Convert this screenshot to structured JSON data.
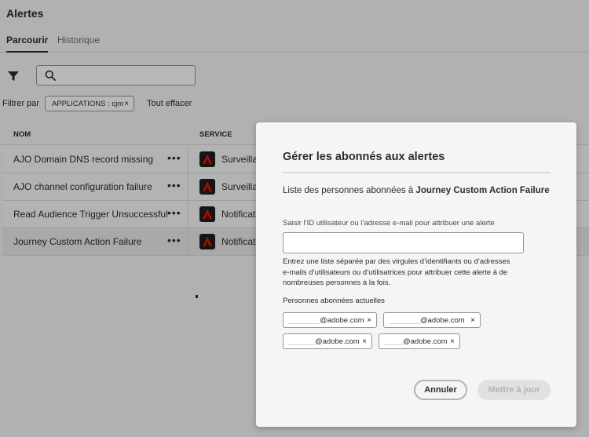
{
  "page": {
    "title": "Alertes"
  },
  "tabs": [
    {
      "label": "Parcourir",
      "active": true
    },
    {
      "label": "Historique",
      "active": false
    }
  ],
  "toolbar": {
    "search_value": "",
    "filter_icon": "filter-icon",
    "search_icon": "search-icon"
  },
  "filters": {
    "label": "Filtrer par",
    "chip": "APPLICATIONS : cjm",
    "chip_remove": "×",
    "clear_all": "Tout effacer"
  },
  "table": {
    "columns": [
      "NOM",
      "SERVICE"
    ],
    "rows": [
      {
        "name": "AJO Domain DNS record missing",
        "more": "•••",
        "service": "Surveillan"
      },
      {
        "name": "AJO channel configuration failure",
        "more": "•••",
        "service": "Surveillan"
      },
      {
        "name": "Read Audience Trigger Unsuccessful",
        "more": "•••",
        "service": "Notificatio"
      },
      {
        "name": "Journey Custom Action Failure",
        "more": "•••",
        "service": "Notificatio"
      }
    ]
  },
  "modal": {
    "title": "Gérer les abonnés aux alertes",
    "subtitle_prefix": "Liste des personnes abonnées à",
    "subtitle_alert": "Journey Custom Action Failure",
    "field_label": "Saisir l’ID utilisateur ou l’adresse e-mail pour attribuer une alerte",
    "field_value": "",
    "help_text": "Entrez une liste séparée par des virgules d’identifiants ou d’adresses e-mails d’utilisateurs ou d’utilisatrices pour attribuer cette alerte à de nombreuses personnes à la fois.",
    "current_label": "Personnes abonnées actuelles",
    "subscribers": [
      {
        "email": "@adobe.com",
        "remove": "×"
      },
      {
        "email": "@adobe.com",
        "remove": "×"
      },
      {
        "email": "@adobe.com",
        "remove": "×"
      },
      {
        "email": "@adobe.com",
        "remove": "×"
      }
    ],
    "cancel_label": "Annuler",
    "update_label": "Mettre à jour"
  },
  "colors": {
    "brand_icon_bg": "#1e1e1e",
    "brand_icon_fg": "#eb1000",
    "disabled_button": "#e1e1e1"
  }
}
